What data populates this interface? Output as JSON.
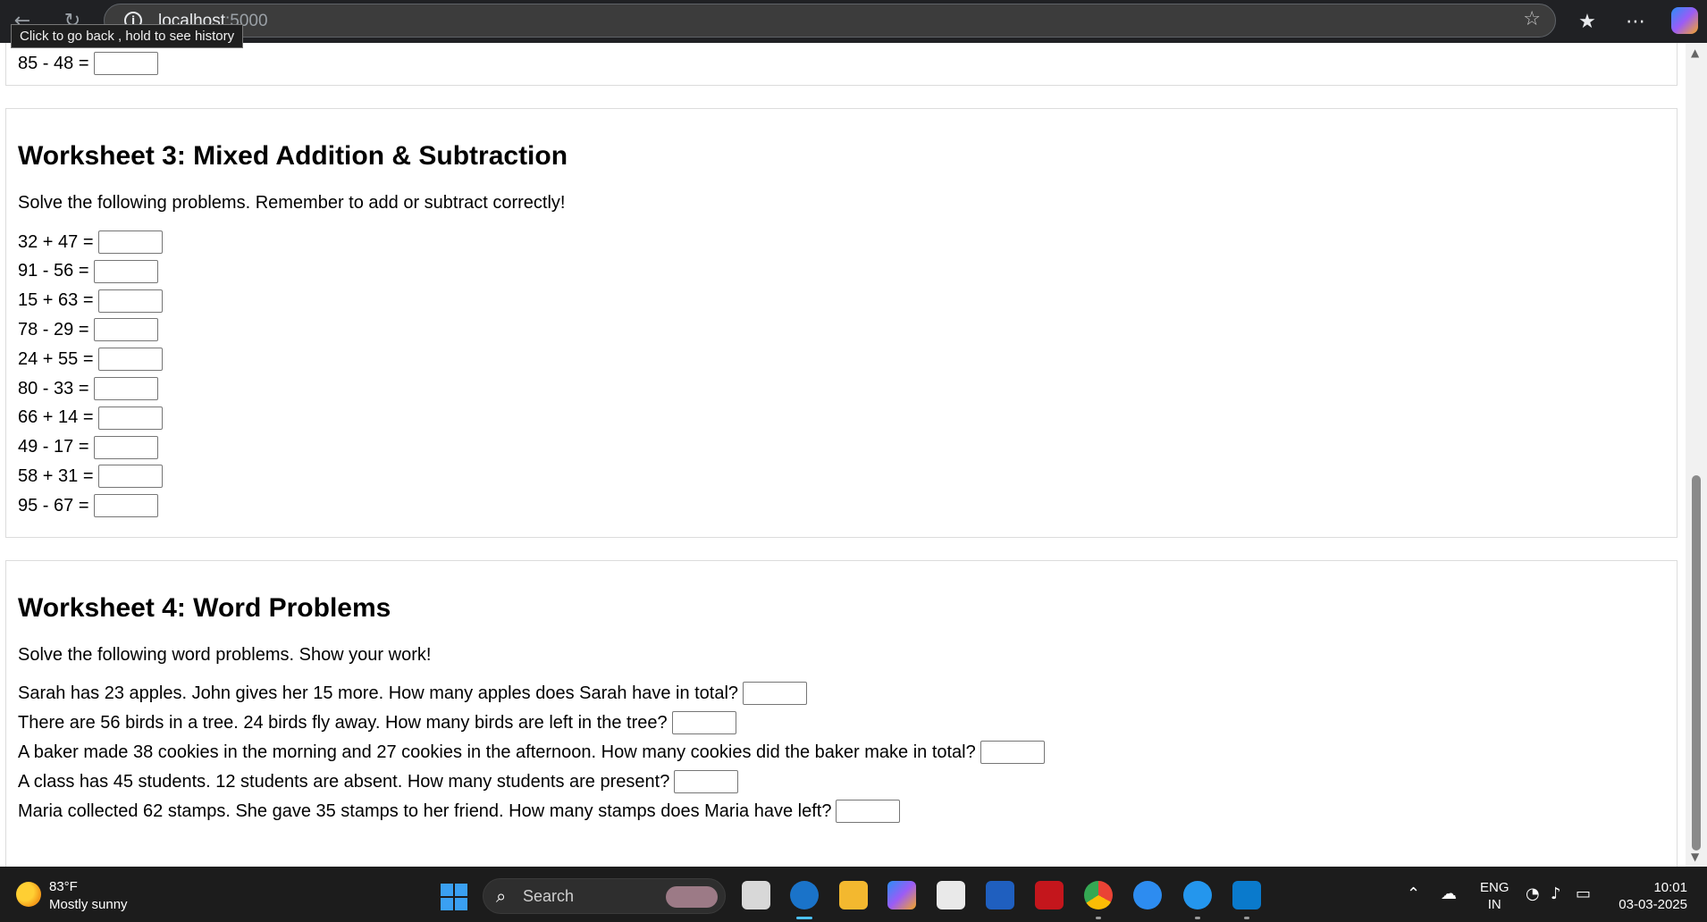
{
  "browser": {
    "host": "localhost",
    "port": ":5000",
    "tooltip": "Click to go back , hold to see history",
    "back_icon": "←",
    "reload_icon": "↻",
    "info_icon": "i",
    "favorite_icon": "☆",
    "favorites_list_icon": "★",
    "more_icon": "⋯"
  },
  "worksheet2": {
    "last_problem": "85 - 48 ="
  },
  "worksheet3": {
    "title": "Worksheet 3: Mixed Addition & Subtraction",
    "instructions": "Solve the following problems. Remember to add or subtract correctly!",
    "problems": [
      "32 + 47 =",
      "91 - 56 =",
      "15 + 63 =",
      "78 - 29 =",
      "24 + 55 =",
      "80 - 33 =",
      "66 + 14 =",
      "49 - 17 =",
      "58 + 31 =",
      "95 - 67 ="
    ]
  },
  "worksheet4": {
    "title": "Worksheet 4: Word Problems",
    "instructions": "Solve the following word problems. Show your work!",
    "problems": [
      "Sarah has 23 apples. John gives her 15 more. How many apples does Sarah have in total?",
      "There are 56 birds in a tree. 24 birds fly away. How many birds are left in the tree?",
      "A baker made 38 cookies in the morning and 27 cookies in the afternoon. How many cookies did the baker make in total?",
      "A class has 45 students. 12 students are absent. How many students are present?",
      "Maria collected 62 stamps. She gave 35 stamps to her friend. How many stamps does Maria have left?"
    ]
  },
  "taskbar": {
    "weather_temp": "83°F",
    "weather_desc": "Mostly sunny",
    "search_label": "Search",
    "search_icon": "⌕",
    "lang_top": "ENG",
    "lang_bottom": "IN",
    "time": "10:01",
    "date": "03-03-2025",
    "apps": [
      "task-view",
      "edge",
      "file-explorer",
      "copilot",
      "microsoft-store",
      "myhp",
      "mcafee",
      "chrome",
      "get-help",
      "docker",
      "vscode"
    ]
  }
}
